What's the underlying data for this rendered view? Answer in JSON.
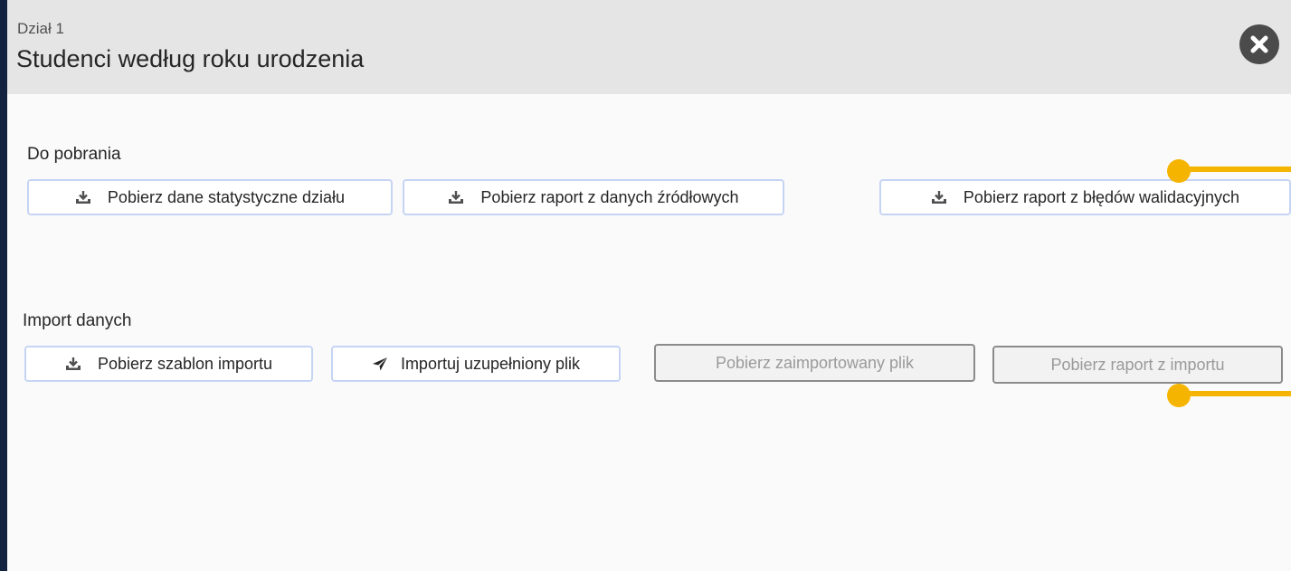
{
  "dialog": {
    "section_label": "Dział 1",
    "title": "Studenci według roku urodzenia",
    "close_icon": "close-circle-icon"
  },
  "downloads": {
    "label": "Do pobrania",
    "buttons": [
      {
        "label": "Pobierz dane statystyczne działu",
        "icon": "download-icon",
        "enabled": true
      },
      {
        "label": "Pobierz raport z danych źródłowych",
        "icon": "download-icon",
        "enabled": true
      },
      {
        "label": "Pobierz raport z błędów walidacyjnych",
        "icon": "download-icon",
        "enabled": true
      }
    ]
  },
  "import": {
    "label": "Import danych",
    "buttons": [
      {
        "label": "Pobierz szablon importu",
        "icon": "download-icon",
        "enabled": true
      },
      {
        "label": "Importuj uzupełniony plik",
        "icon": "send-icon",
        "enabled": true
      },
      {
        "label": "Pobierz zaimportowany plik",
        "enabled": false
      },
      {
        "label": "Pobierz raport z importu",
        "enabled": false
      }
    ]
  },
  "colors": {
    "background": "#12223f",
    "header": "#e5e5e5",
    "button_border": "#c6d4f4",
    "callout": "#f4b400"
  }
}
